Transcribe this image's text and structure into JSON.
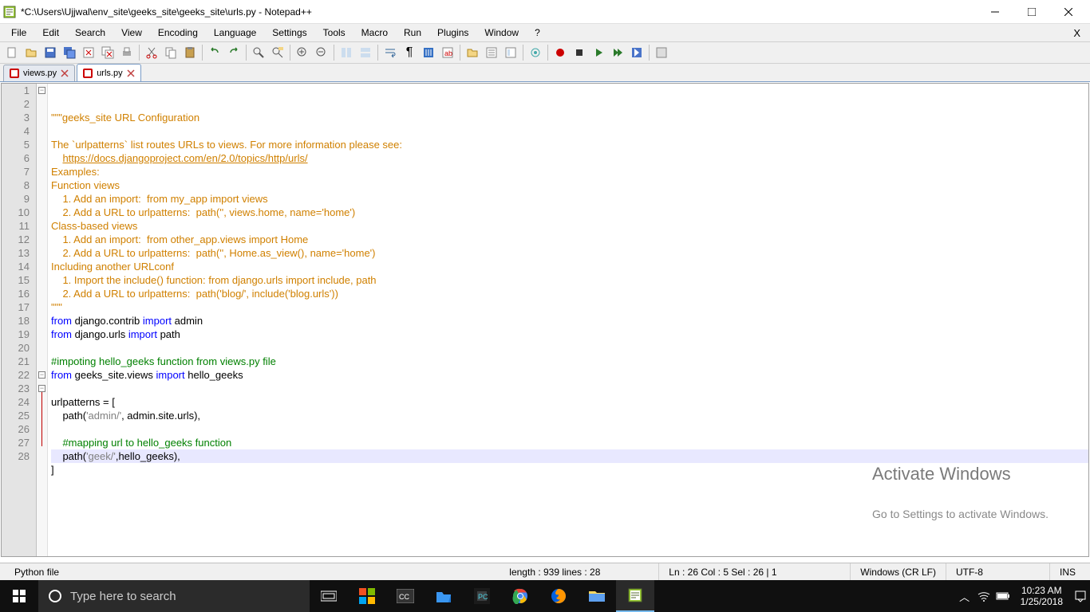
{
  "window": {
    "title": "*C:\\Users\\Ujjwal\\env_site\\geeks_site\\geeks_site\\urls.py - Notepad++"
  },
  "menu": {
    "items": [
      "File",
      "Edit",
      "Search",
      "View",
      "Encoding",
      "Language",
      "Settings",
      "Tools",
      "Macro",
      "Run",
      "Plugins",
      "Window",
      "?"
    ]
  },
  "tabs": [
    {
      "label": "views.py",
      "active": false
    },
    {
      "label": "urls.py",
      "active": true
    }
  ],
  "lines": [
    {
      "n": 1,
      "fold": "minus",
      "seg": [
        [
          "doc",
          "\"\"\"geeks_site URL Configuration"
        ]
      ]
    },
    {
      "n": 2,
      "seg": [
        [
          "doc",
          ""
        ]
      ]
    },
    {
      "n": 3,
      "seg": [
        [
          "doc",
          "The `urlpatterns` list routes URLs to views. For more information please see:"
        ]
      ]
    },
    {
      "n": 4,
      "seg": [
        [
          "doc",
          "    "
        ],
        [
          "link",
          "https://docs.djangoproject.com/en/2.0/topics/http/urls/"
        ]
      ]
    },
    {
      "n": 5,
      "seg": [
        [
          "doc",
          "Examples:"
        ]
      ]
    },
    {
      "n": 6,
      "seg": [
        [
          "doc",
          "Function views"
        ]
      ]
    },
    {
      "n": 7,
      "seg": [
        [
          "doc",
          "    1. Add an import:  from my_app import views"
        ]
      ]
    },
    {
      "n": 8,
      "seg": [
        [
          "doc",
          "    2. Add a URL to urlpatterns:  path('', views.home, name='home')"
        ]
      ]
    },
    {
      "n": 9,
      "seg": [
        [
          "doc",
          "Class-based views"
        ]
      ]
    },
    {
      "n": 10,
      "seg": [
        [
          "doc",
          "    1. Add an import:  from other_app.views import Home"
        ]
      ]
    },
    {
      "n": 11,
      "seg": [
        [
          "doc",
          "    2. Add a URL to urlpatterns:  path('', Home.as_view(), name='home')"
        ]
      ]
    },
    {
      "n": 12,
      "seg": [
        [
          "doc",
          "Including another URLconf"
        ]
      ]
    },
    {
      "n": 13,
      "seg": [
        [
          "doc",
          "    1. Import the include() function: from django.urls import include, path"
        ]
      ]
    },
    {
      "n": 14,
      "seg": [
        [
          "doc",
          "    2. Add a URL to urlpatterns:  path('blog/', include('blog.urls'))"
        ]
      ]
    },
    {
      "n": 15,
      "seg": [
        [
          "doc",
          "\"\"\""
        ]
      ]
    },
    {
      "n": 16,
      "seg": [
        [
          "kw",
          "from"
        ],
        [
          "plain",
          " django.contrib "
        ],
        [
          "kw",
          "import"
        ],
        [
          "plain",
          " admin"
        ]
      ]
    },
    {
      "n": 17,
      "seg": [
        [
          "kw",
          "from"
        ],
        [
          "plain",
          " django.urls "
        ],
        [
          "kw",
          "import"
        ],
        [
          "plain",
          " path"
        ]
      ]
    },
    {
      "n": 18,
      "seg": [
        [
          "plain",
          ""
        ]
      ]
    },
    {
      "n": 19,
      "seg": [
        [
          "com",
          "#impoting hello_geeks function from views.py file"
        ]
      ]
    },
    {
      "n": 20,
      "seg": [
        [
          "kw",
          "from"
        ],
        [
          "plain",
          " geeks_site.views "
        ],
        [
          "kw",
          "import"
        ],
        [
          "plain",
          " hello_geeks"
        ]
      ]
    },
    {
      "n": 21,
      "seg": [
        [
          "plain",
          ""
        ]
      ]
    },
    {
      "n": 22,
      "fold": "minus",
      "seg": [
        [
          "plain",
          "urlpatterns = ["
        ]
      ]
    },
    {
      "n": 23,
      "fold": "minus",
      "seg": [
        [
          "plain",
          "    path("
        ],
        [
          "str",
          "'admin/'"
        ],
        [
          "plain",
          ", admin.site.urls),"
        ]
      ]
    },
    {
      "n": 24,
      "seg": [
        [
          "plain",
          ""
        ]
      ]
    },
    {
      "n": 25,
      "seg": [
        [
          "plain",
          "    "
        ],
        [
          "com",
          "#mapping url to hello_geeks function"
        ]
      ]
    },
    {
      "n": 26,
      "hl": true,
      "seg": [
        [
          "plain",
          "    path("
        ],
        [
          "str",
          "'geek/'"
        ],
        [
          "plain",
          ",hello_geeks),"
        ]
      ]
    },
    {
      "n": 27,
      "seg": [
        [
          "plain",
          "]"
        ]
      ]
    },
    {
      "n": 28,
      "seg": [
        [
          "plain",
          ""
        ]
      ]
    }
  ],
  "watermark": {
    "title": "Activate Windows",
    "sub": "Go to Settings to activate Windows."
  },
  "status": {
    "filetype": "Python file",
    "length": "length : 939    lines : 28",
    "pos": "Ln : 26    Col : 5    Sel : 26 | 1",
    "eol": "Windows (CR LF)",
    "enc": "UTF-8",
    "mode": "INS"
  },
  "taskbar": {
    "search_placeholder": "Type here to search",
    "time": "10:23 AM",
    "date": "1/25/2018"
  }
}
